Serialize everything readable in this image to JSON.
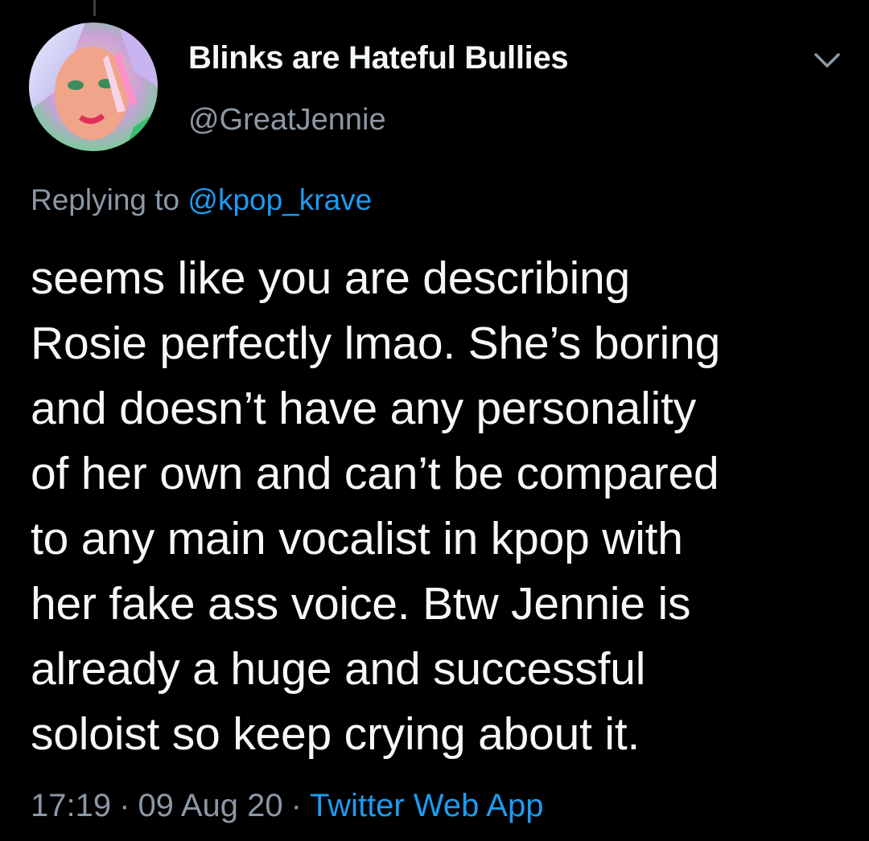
{
  "author": {
    "display_name": "Blinks are Hateful Bullies",
    "handle": "@GreatJennie",
    "avatar": "avatar-photo"
  },
  "reply": {
    "prefix": "Replying to ",
    "mention": "@kpop_krave"
  },
  "tweet": {
    "lines": [
      "seems like you are describing",
      "Rosie perfectly lmao. She’s boring",
      "and doesn’t have any personality",
      "of her own and can’t be compared",
      "to any main vocalist in kpop with",
      "her fake ass voice. Btw Jennie is",
      "already a huge and successful",
      "soloist so keep crying about it."
    ]
  },
  "meta": {
    "time": "17:19",
    "separator": "·",
    "date": "09 Aug 20",
    "source": "Twitter Web App"
  },
  "icons": {
    "menu": "chevron-down-icon"
  },
  "colors": {
    "background": "#000000",
    "link": "#1d9bf0",
    "secondary_text": "#8b98a5",
    "primary_text": "#f5f8fa"
  }
}
